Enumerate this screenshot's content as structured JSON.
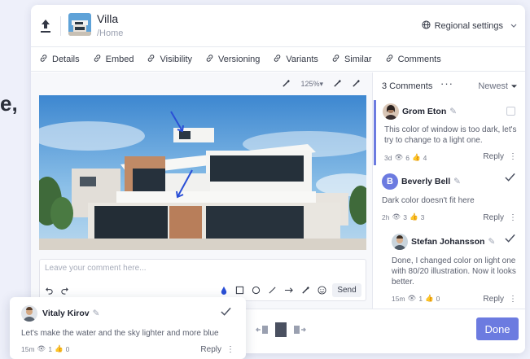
{
  "background_text": "e,",
  "header": {
    "title": "Villa",
    "breadcrumb": "/Home",
    "regional_label": "Regional settings"
  },
  "tabs": [
    {
      "label": "Details",
      "icon": "link-icon"
    },
    {
      "label": "Embed",
      "icon": "link-icon"
    },
    {
      "label": "Visibility",
      "icon": "link-icon"
    },
    {
      "label": "Versioning",
      "icon": "link-icon"
    },
    {
      "label": "Variants",
      "icon": "link-icon"
    },
    {
      "label": "Similar",
      "icon": "link-icon"
    },
    {
      "label": "Comments",
      "icon": "link-icon"
    }
  ],
  "image_toolbar": {
    "zoom": "125%"
  },
  "comment_box": {
    "placeholder": "Leave your comment here...",
    "send_label": "Send"
  },
  "comments_panel": {
    "count_label": "3 Comments",
    "more": "···",
    "sort": "Newest",
    "comments": [
      {
        "name": "Grom Eton",
        "body": "This color of window is too dark, let's try to change to a light one.",
        "age": "3d",
        "views": "6",
        "likes": "4",
        "reply": "Reply"
      },
      {
        "name": "Beverly Bell",
        "initial": "B",
        "body": "Dark color doesn't fit here",
        "age": "2h",
        "views": "3",
        "likes": "3",
        "reply": "Reply"
      },
      {
        "name": "Stefan Johansson",
        "body": "Done, I changed color on light one with 80/20 illustration. Now it looks better.",
        "age": "15m",
        "views": "1",
        "likes": "0",
        "reply": "Reply"
      }
    ]
  },
  "floating_comment": {
    "name": "Vitaly Kirov",
    "body": "Let's make the water and the sky lighter and more blue",
    "age": "15m",
    "views": "1",
    "likes": "0",
    "reply": "Reply"
  },
  "done_label": "Done",
  "colors": {
    "accent": "#6c7be0",
    "annotation_arrow": "#2a4fd6"
  }
}
